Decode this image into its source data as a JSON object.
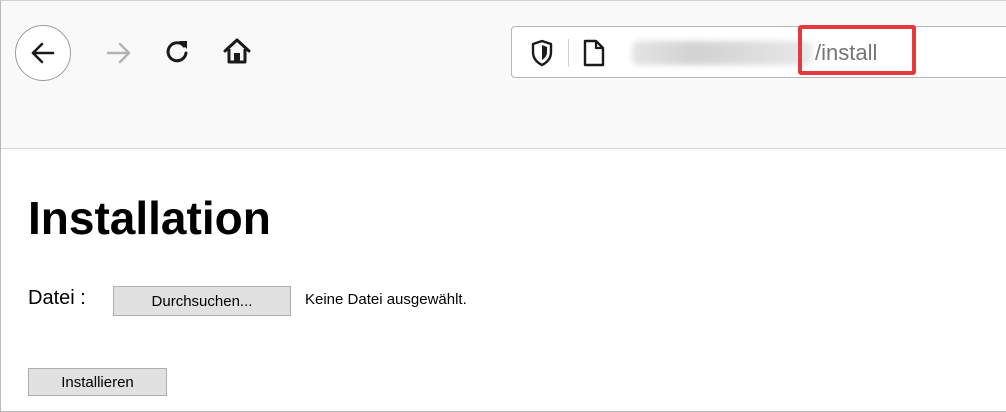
{
  "browser": {
    "url_path": "/install",
    "icons": {
      "back": "back-arrow-icon",
      "forward": "forward-arrow-icon",
      "reload": "reload-icon",
      "home": "home-icon",
      "tracking": "shield-icon",
      "page": "page-icon"
    },
    "highlight_color": "#e7383c"
  },
  "page": {
    "title": "Installation",
    "file_label": "Datei :",
    "browse_button_label": "Durchsuchen...",
    "no_file_text": "Keine Datei ausgewählt.",
    "install_button_label": "Installieren"
  }
}
